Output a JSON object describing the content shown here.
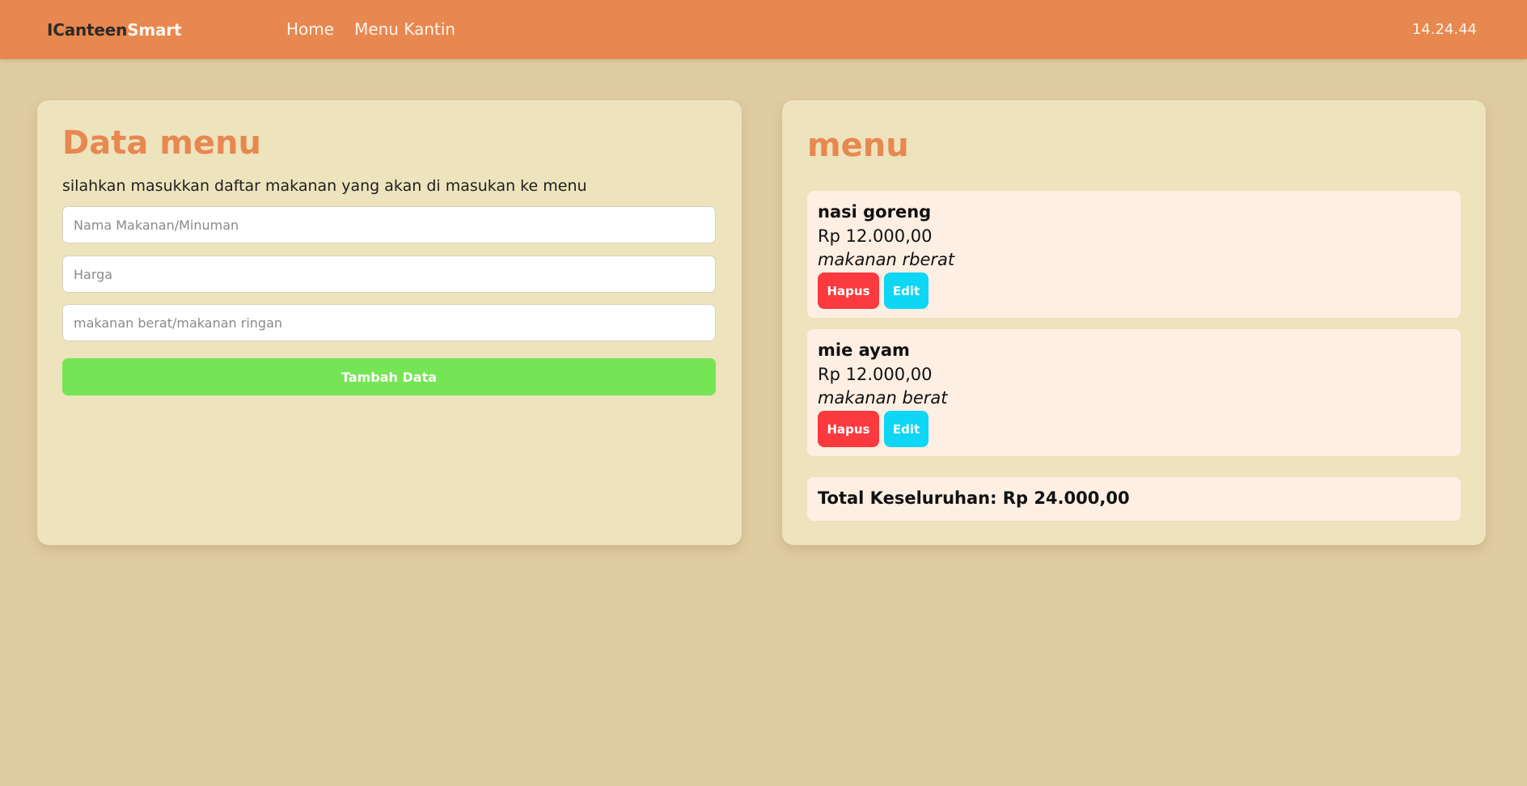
{
  "navbar": {
    "brand_part1": "ICanteen",
    "brand_part2": "Smart",
    "links": [
      "Home",
      "Menu Kantin"
    ],
    "clock": "14.24.44"
  },
  "form_panel": {
    "title": "Data menu",
    "subtitle": "silahkan masukkan daftar makanan yang akan di masukan ke menu",
    "name_placeholder": "Nama Makanan/Minuman",
    "name_value": "",
    "price_placeholder": "Harga",
    "price_value": "",
    "category_placeholder": "makanan berat/makanan ringan",
    "category_value": "",
    "submit_label": "Tambah Data"
  },
  "menu_panel": {
    "title": "menu",
    "items": [
      {
        "name": "nasi goreng",
        "price": "Rp 12.000,00",
        "category": "makanan rberat",
        "delete_label": "Hapus",
        "edit_label": "Edit"
      },
      {
        "name": "mie ayam",
        "price": "Rp 12.000,00",
        "category": "makanan berat",
        "delete_label": "Hapus",
        "edit_label": "Edit"
      }
    ],
    "total": "Total Keseluruhan: Rp 24.000,00"
  },
  "colors": {
    "background": "#e0cca2",
    "navbar": "#e78851",
    "card": "#ede3bc",
    "accent": "#e78851",
    "add_button": "#76e555",
    "delete_button": "#fb3a3f",
    "edit_button": "#0ed6f5",
    "item_card": "#fdefe3"
  }
}
